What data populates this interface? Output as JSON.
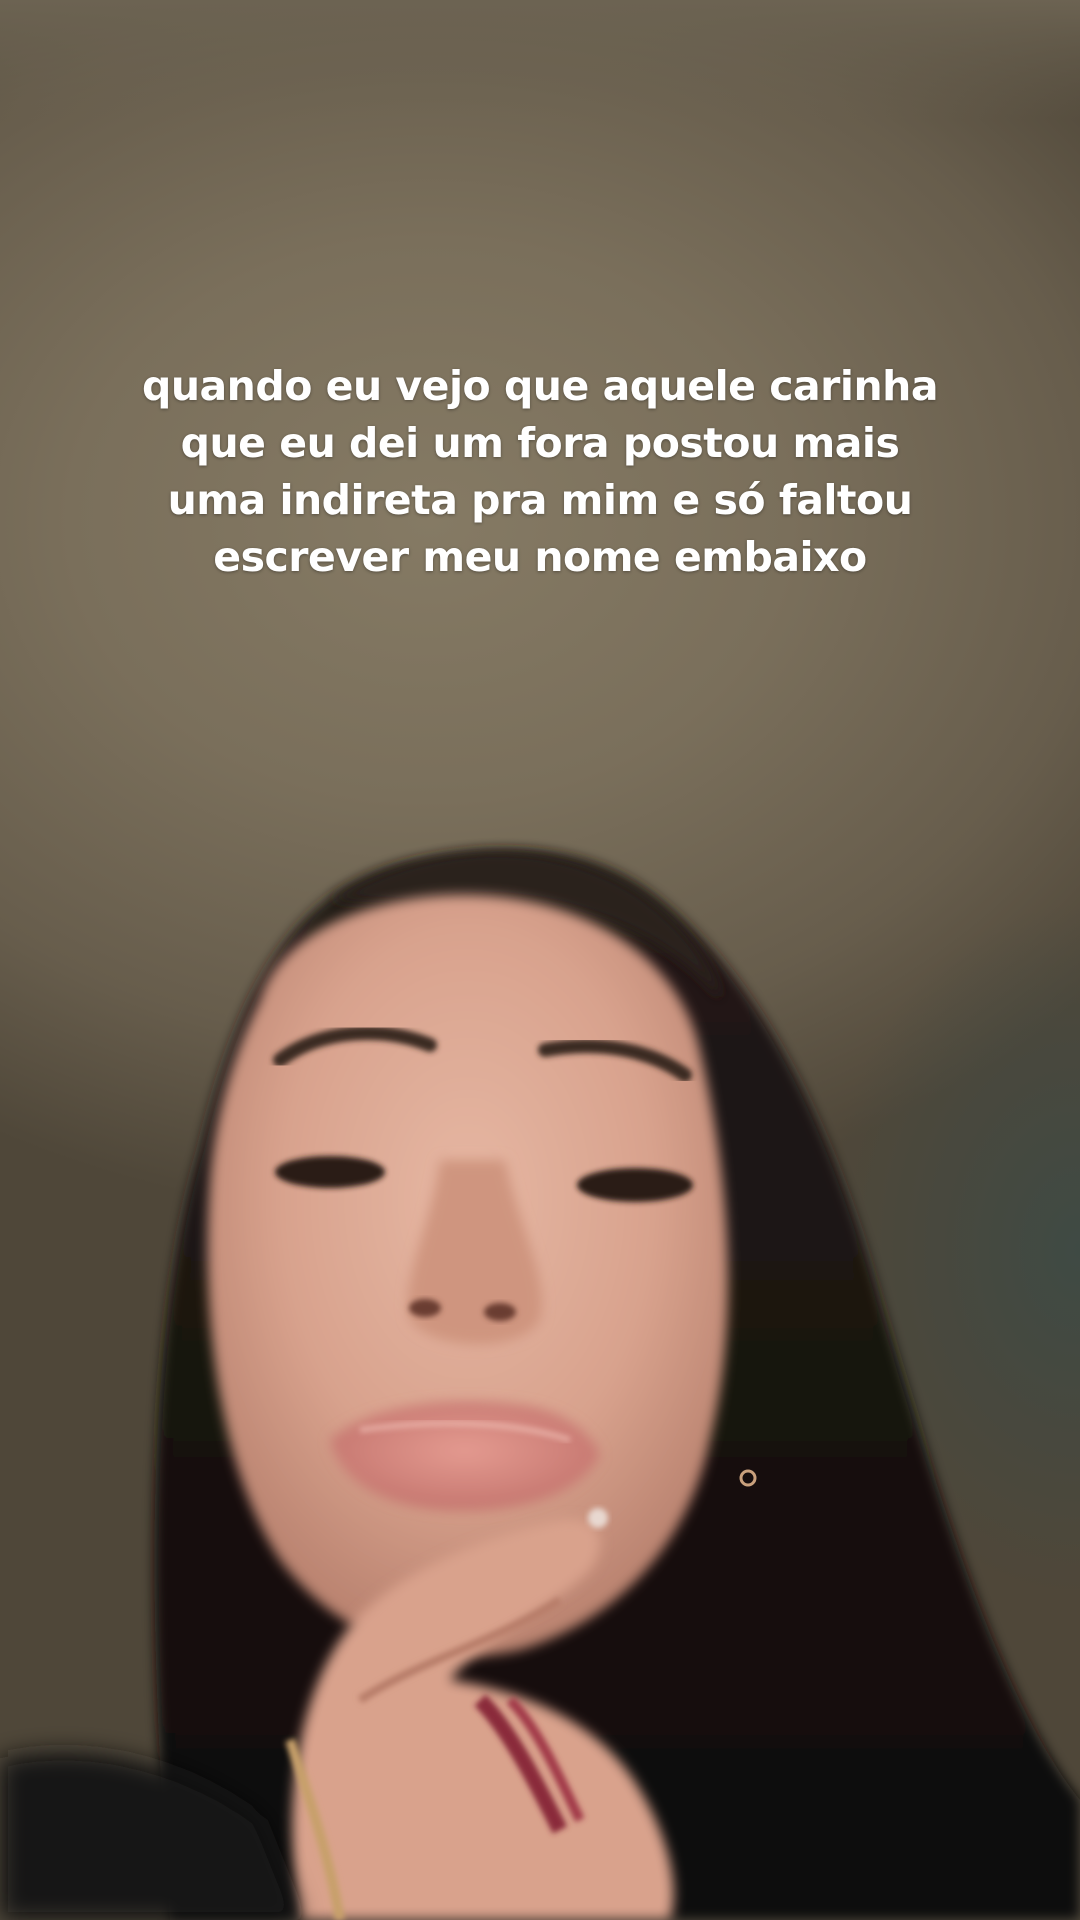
{
  "caption": {
    "lines": [
      "quando eu vejo que aquele carinha",
      "que eu dei um fora postou mais",
      "uma indireta pra mim e só faltou",
      "escrever meu nome embaixo"
    ]
  },
  "scene": {
    "description_icon": "selfie-photo",
    "background_color": "#7a6f5b",
    "text_color": "#ffffff"
  }
}
